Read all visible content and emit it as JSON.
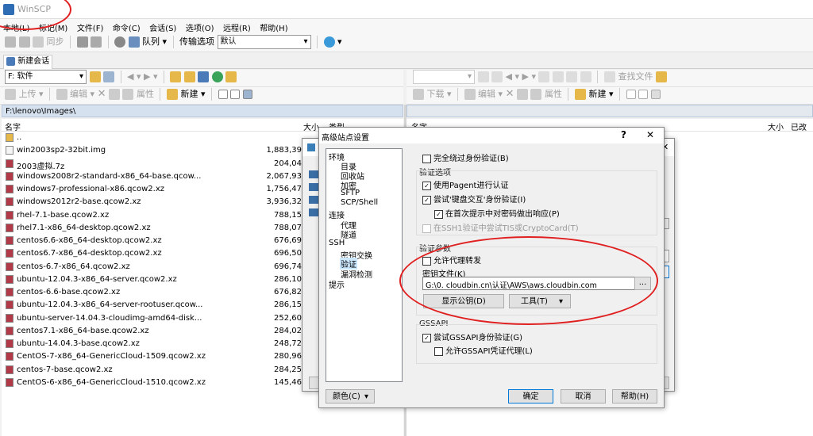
{
  "window": {
    "title": "WinSCP"
  },
  "menu": [
    "本地(L)",
    "标记(M)",
    "文件(F)",
    "命令(C)",
    "会话(S)",
    "选项(O)",
    "远程(R)",
    "帮助(H)"
  ],
  "toolbar": {
    "sync_label": "同步",
    "queue_label": "队列",
    "transfer_options_label": "传输选项",
    "transfer_mode": "默认"
  },
  "session_tab": {
    "new_session_label": "新建会话"
  },
  "local": {
    "drive": "F: 软件",
    "path": "F:\\lenovo\\Images\\",
    "toolbar": {
      "upload": "上传",
      "edit": "编辑",
      "properties": "属性",
      "new": "新建"
    },
    "columns": {
      "name": "名字",
      "size": "大小",
      "type": "类型"
    },
    "files": [
      {
        "name": "..",
        "size": ""
      },
      {
        "name": "win2003sp2-32bit.img",
        "size": "1,883,39"
      },
      {
        "name": "2003虚拟.7z",
        "size": "204,04"
      },
      {
        "name": "windows2008r2-standard-x86_64-base.qcow...",
        "size": "2,067,93"
      },
      {
        "name": "windows7-professional-x86.qcow2.xz",
        "size": "1,756,47"
      },
      {
        "name": "windows2012r2-base.qcow2.xz",
        "size": "3,936,32"
      },
      {
        "name": "rhel-7.1-base.qcow2.xz",
        "size": "788,15"
      },
      {
        "name": "rhel7.1-x86_64-desktop.qcow2.xz",
        "size": "788,07"
      },
      {
        "name": "centos6.6-x86_64-desktop.qcow2.xz",
        "size": "676,69"
      },
      {
        "name": "centos6.7-x86_64-desktop.qcow2.xz",
        "size": "696,50"
      },
      {
        "name": "centos-6.7-x86_64.qcow2.xz",
        "size": "696,74"
      },
      {
        "name": "ubuntu-12.04.3-x86_64-server.qcow2.xz",
        "size": "286,10"
      },
      {
        "name": "centos-6.6-base.qcow2.xz",
        "size": "676,82"
      },
      {
        "name": "ubuntu-12.04.3-x86_64-server-rootuser.qcow...",
        "size": "286,15"
      },
      {
        "name": "ubuntu-server-14.04.3-cloudimg-amd64-disk...",
        "size": "252,60"
      },
      {
        "name": "centos7.1-x86_64-base.qcow2.xz",
        "size": "284,02"
      },
      {
        "name": "ubuntu-14.04.3-base.qcow2.xz",
        "size": "248,72"
      },
      {
        "name": "CentOS-7-x86_64-GenericCloud-1509.qcow2.xz",
        "size": "280,96"
      },
      {
        "name": "centos-7-base.qcow2.xz",
        "size": "284,25"
      },
      {
        "name": "CentOS-6-x86_64-GenericCloud-1510.qcow2.xz",
        "size": "145,46"
      }
    ]
  },
  "remote": {
    "toolbar": {
      "find_files": "查找文件",
      "download": "下载",
      "edit": "编辑",
      "properties": "属性",
      "new": "新建"
    },
    "columns": {
      "name": "名字",
      "size": "大小",
      "changed": "已改变"
    }
  },
  "dialog": {
    "title": "高级站点设置",
    "help_mark": "?",
    "close": "✕",
    "tree": {
      "env": "环境",
      "dir": "目录",
      "recycle": "回收站",
      "encrypt": "加密",
      "sftp": "SFTP",
      "scp": "SCP/Shell",
      "connection": "连接",
      "proxy": "代理",
      "tunnel": "隧道",
      "ssh": "SSH",
      "kex": "密钥交换",
      "auth": "验证",
      "bugs": "漏洞检测",
      "note": "提示"
    },
    "bypass_auth": "完全绕过身份验证(B)",
    "auth_options": "验证选项",
    "use_pageant": "使用Pagent进行认证",
    "keyboard_interactive": "尝试'键盘交互'身份验证(I)",
    "respond_password": "在首次提示中对密码做出响应(P)",
    "ssh1_tis": "在SSH1验证中尝试TIS或CryptoCard(T)",
    "auth_params": "验证参数",
    "agent_forwarding": "允许代理转发",
    "key_file_label": "密钥文件(K)",
    "key_file_value": "G:\\0. cloudbin.cn\\认证\\AWS\\aws.cloudbin.com",
    "browse": "...",
    "show_public_key": "显示公钥(D)",
    "tools": "工具(T)",
    "gssapi": "GSSAPI",
    "gssapi_auth": "尝试GSSAPI身份验证(G)",
    "gssapi_delegation": "允许GSSAPI凭证代理(L)",
    "color": "颜色(C)",
    "ok": "确定",
    "cancel": "取消",
    "help": "帮助(H)"
  },
  "colors": {
    "annotation": "#e02020",
    "path_bar": "#d6e1ef",
    "accent": "#0078d7"
  }
}
